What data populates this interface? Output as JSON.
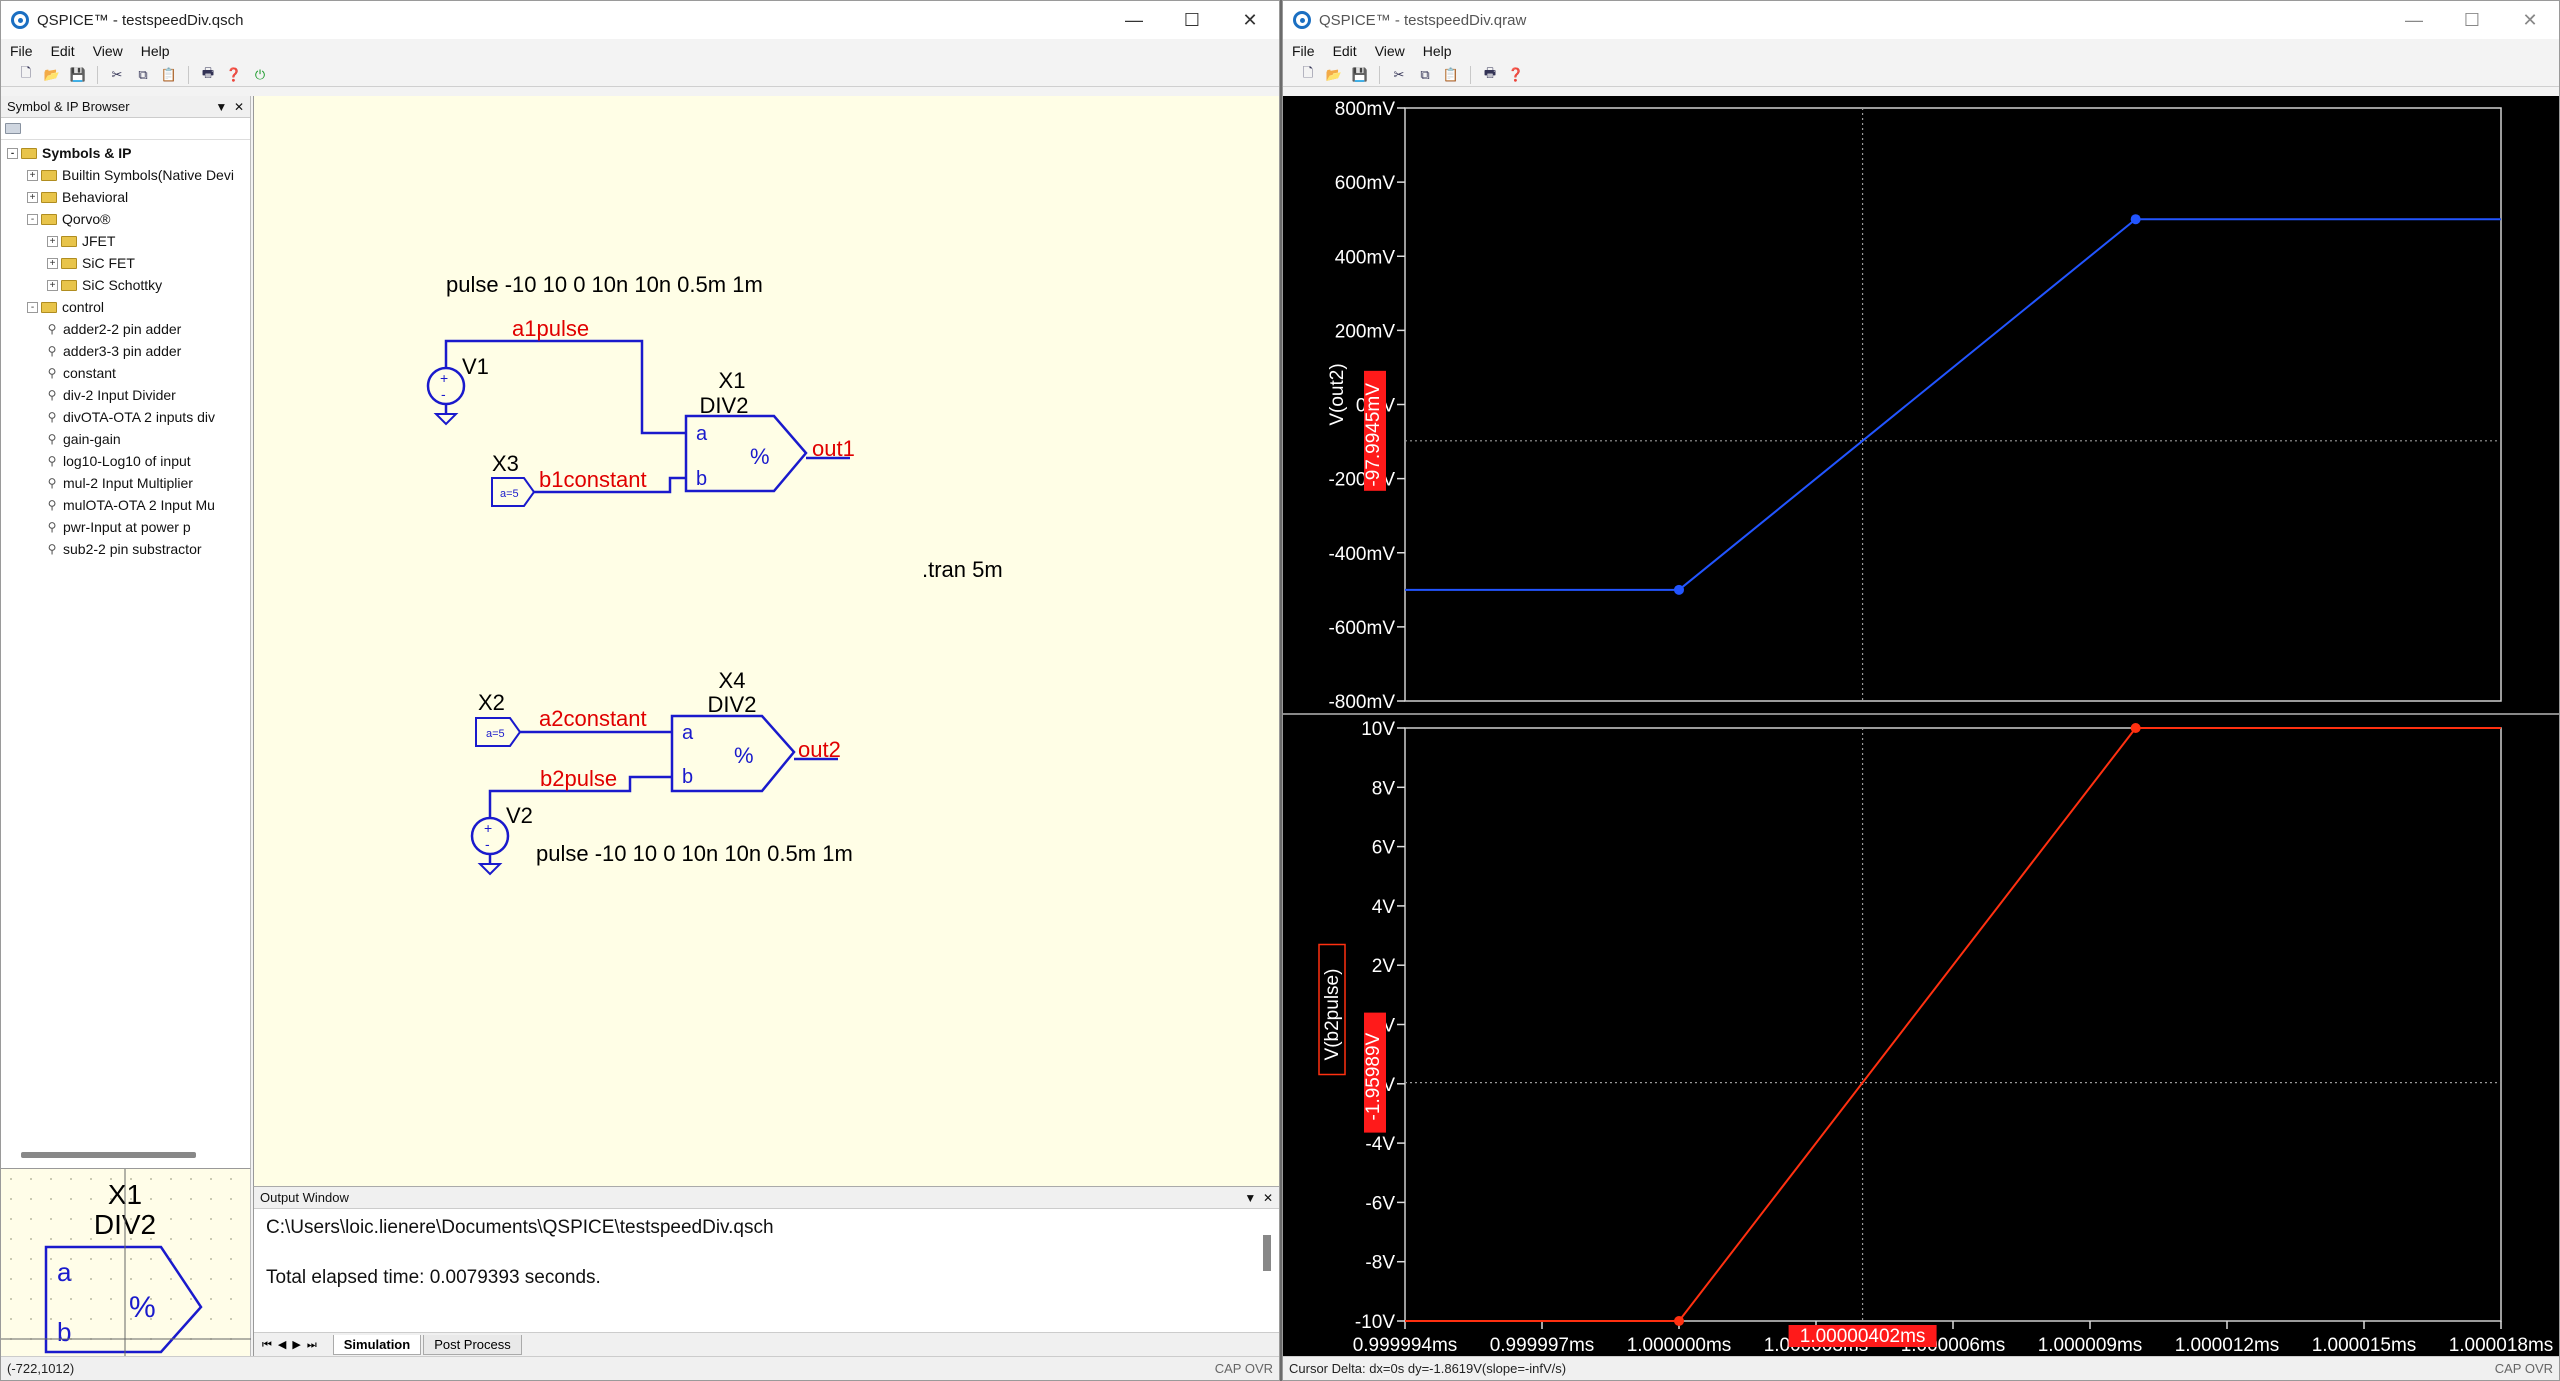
{
  "left_window": {
    "title": "QSPICE™ - testspeedDiv.qsch",
    "menu": [
      "File",
      "Edit",
      "View",
      "Help"
    ],
    "browser": {
      "title": "Symbol & IP Browser",
      "root": "Symbols & IP",
      "items": [
        {
          "label": "Builtin Symbols(Native Devi",
          "level": 1,
          "type": "folder",
          "exp": "+"
        },
        {
          "label": "Behavioral",
          "level": 1,
          "type": "folder",
          "exp": "+"
        },
        {
          "label": "Qorvo®",
          "level": 1,
          "type": "folder",
          "exp": "-"
        },
        {
          "label": "JFET",
          "level": 2,
          "type": "folder",
          "exp": "+"
        },
        {
          "label": "SiC FET",
          "level": 2,
          "type": "folder",
          "exp": "+"
        },
        {
          "label": "SiC Schottky",
          "level": 2,
          "type": "folder",
          "exp": "+"
        },
        {
          "label": "control",
          "level": 1,
          "type": "folder",
          "exp": "-"
        },
        {
          "label": "adder2-2 pin adder",
          "level": 2,
          "type": "leaf"
        },
        {
          "label": "adder3-3 pin adder",
          "level": 2,
          "type": "leaf"
        },
        {
          "label": "constant",
          "level": 2,
          "type": "leaf"
        },
        {
          "label": "div-2 Input Divider",
          "level": 2,
          "type": "leaf"
        },
        {
          "label": "divOTA-OTA 2 inputs div",
          "level": 2,
          "type": "leaf"
        },
        {
          "label": "gain-gain",
          "level": 2,
          "type": "leaf"
        },
        {
          "label": "log10-Log10 of input",
          "level": 2,
          "type": "leaf"
        },
        {
          "label": "mul-2 Input Multiplier",
          "level": 2,
          "type": "leaf"
        },
        {
          "label": "mulOTA-OTA 2 Input Mu",
          "level": 2,
          "type": "leaf"
        },
        {
          "label": "pwr-Input at power p",
          "level": 2,
          "type": "leaf"
        },
        {
          "label": "sub2-2 pin substractor",
          "level": 2,
          "type": "leaf"
        }
      ]
    },
    "preview": {
      "name": "X1",
      "type": "DIV2",
      "pin_a": "a",
      "pin_b": "b",
      "op": "%"
    },
    "schematic": {
      "pulse1": "pulse -10 10 0 10n 10n 0.5m 1m",
      "pulse2": "pulse -10 10 0 10n 10n 0.5m 1m",
      "tran": ".tran 5m",
      "v1": "V1",
      "v2": "V2",
      "x1": "X1",
      "x1_type": "DIV2",
      "x4": "X4",
      "x4_type": "DIV2",
      "x3": "X3",
      "x2": "X2",
      "const_a": "a=5",
      "const_b": "a=5",
      "net_a1": "a1pulse",
      "net_b1": "b1constant",
      "net_a2": "a2constant",
      "net_b2": "b2pulse",
      "out1": "out1",
      "out2": "out2",
      "pin_a": "a",
      "pin_b": "b",
      "op": "%"
    },
    "output": {
      "title": "Output Window",
      "line1": "C:\\Users\\loic.lienere\\Documents\\QSPICE\\testspeedDiv.qsch",
      "line2": "Total elapsed time: 0.0079393 seconds.",
      "tabs": [
        "Simulation",
        "Post Process"
      ]
    },
    "status": {
      "coords": "(-722,1012)",
      "flags": "CAP OVR"
    }
  },
  "right_window": {
    "title": "QSPICE™ - testspeedDiv.qraw",
    "menu": [
      "File",
      "Edit",
      "View",
      "Help"
    ],
    "status": {
      "cursor": "Cursor Delta: dx=0s  dy=-1.8619V(slope=-infV/s)",
      "flags": "CAP OVR"
    },
    "colors": {
      "trace1": "#2255ff",
      "trace2": "#ff3010",
      "cursor_label": "#ff1a1a"
    }
  },
  "chart_data": [
    {
      "type": "line",
      "series": [
        {
          "name": "V(out2)",
          "x": [
            0.999994,
            1.0,
            1.00001,
            1.000018
          ],
          "y": [
            -500,
            -500,
            500,
            500
          ]
        }
      ],
      "xlim": [
        0.999994,
        1.000018
      ],
      "ylim": [
        -800,
        800
      ],
      "yticks": [
        "800mV",
        "600mV",
        "400mV",
        "200mV",
        "0mV",
        "-200mV",
        "-400mV",
        "-600mV",
        "-800mV"
      ],
      "ylabel": "V(out2)",
      "cursor_y_label": "-97.9945mV",
      "cursor_y": -97.9945
    },
    {
      "type": "line",
      "series": [
        {
          "name": "V(b2pulse)",
          "x": [
            0.999994,
            1.0,
            1.00001,
            1.000018
          ],
          "y": [
            -10,
            -10,
            10,
            10
          ]
        }
      ],
      "xlim": [
        0.999994,
        1.000018
      ],
      "ylim": [
        -10,
        10
      ],
      "yticks": [
        "10V",
        "8V",
        "6V",
        "4V",
        "2V",
        "0V",
        "-2V",
        "-4V",
        "-6V",
        "-8V",
        "-10V"
      ],
      "xticks": [
        "0.999994ms",
        "0.999997ms",
        "1.000000ms",
        "1.000003ms",
        "1.000006ms",
        "1.000009ms",
        "1.000012ms",
        "1.000015ms",
        "1.000018ms"
      ],
      "ylabel": "V(b2pulse)",
      "cursor_y_label": "-1.95989V",
      "cursor_y": -1.95989,
      "cursor_x_label": "1.00000402ms",
      "cursor_x": 1.00000402
    }
  ]
}
